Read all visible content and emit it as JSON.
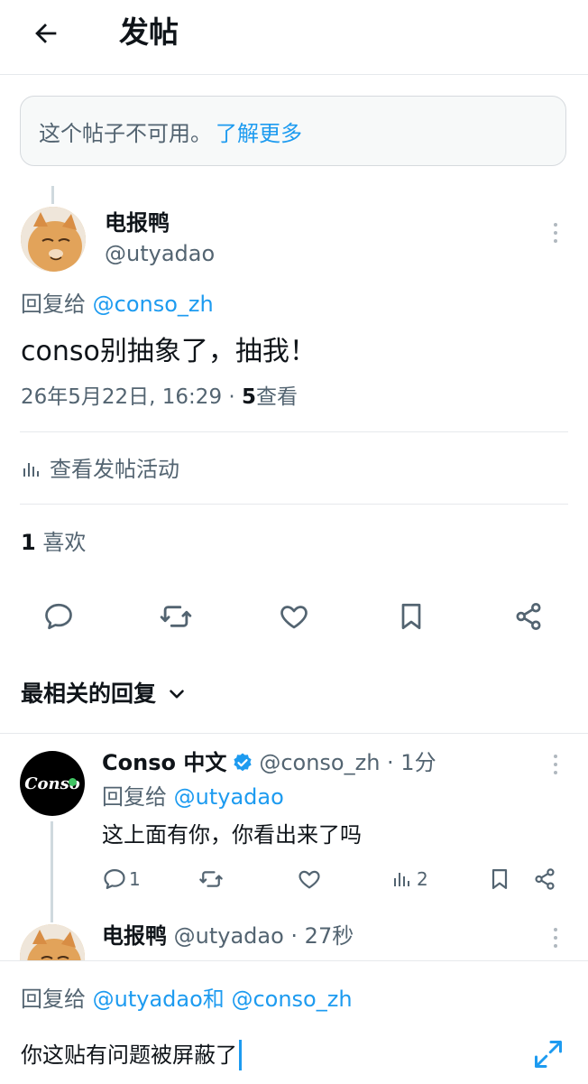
{
  "header": {
    "title": "发帖"
  },
  "notice": {
    "text": "这个帖子不可用。",
    "link": "了解更多"
  },
  "post": {
    "author_name": "电报鸭",
    "author_handle": "@utyadao",
    "reply_to_label": "回复给",
    "reply_to_handle": "@conso_zh",
    "text": "conso别抽象了，抽我！",
    "timestamp": "26年5月22日, 16:29 · ",
    "views_count": "5",
    "views_label": "查看",
    "activity_label": "查看发帖活动",
    "likes_count": "1",
    "likes_label": "喜欢"
  },
  "actions": {
    "reply": "reply-icon",
    "repost": "repost-icon",
    "like": "heart-icon",
    "bookmark": "bookmark-icon",
    "share": "share-icon"
  },
  "sort": {
    "label": "最相关的回复"
  },
  "replies": [
    {
      "name": "Conso 中文",
      "handle": "@conso_zh · 1分",
      "avatar_text": "Conso",
      "reply_to_label": "回复给",
      "reply_to_handle": "@utyadao",
      "text": "这上面有你，你看出来了吗",
      "reply_count": "1",
      "views_count": "2"
    },
    {
      "name": "电报鸭",
      "handle": "@utyadao · 27秒"
    }
  ],
  "composer": {
    "reply_to_label": "回复给",
    "handle_1": "@utyadao",
    "connector": "和",
    "handle_2": "@conso_zh",
    "input_text": "你这贴有问题被屏蔽了"
  },
  "colors": {
    "accent": "#1d9bf0",
    "text": "#0f1419",
    "muted": "#536471",
    "border": "#e6e9ec"
  }
}
